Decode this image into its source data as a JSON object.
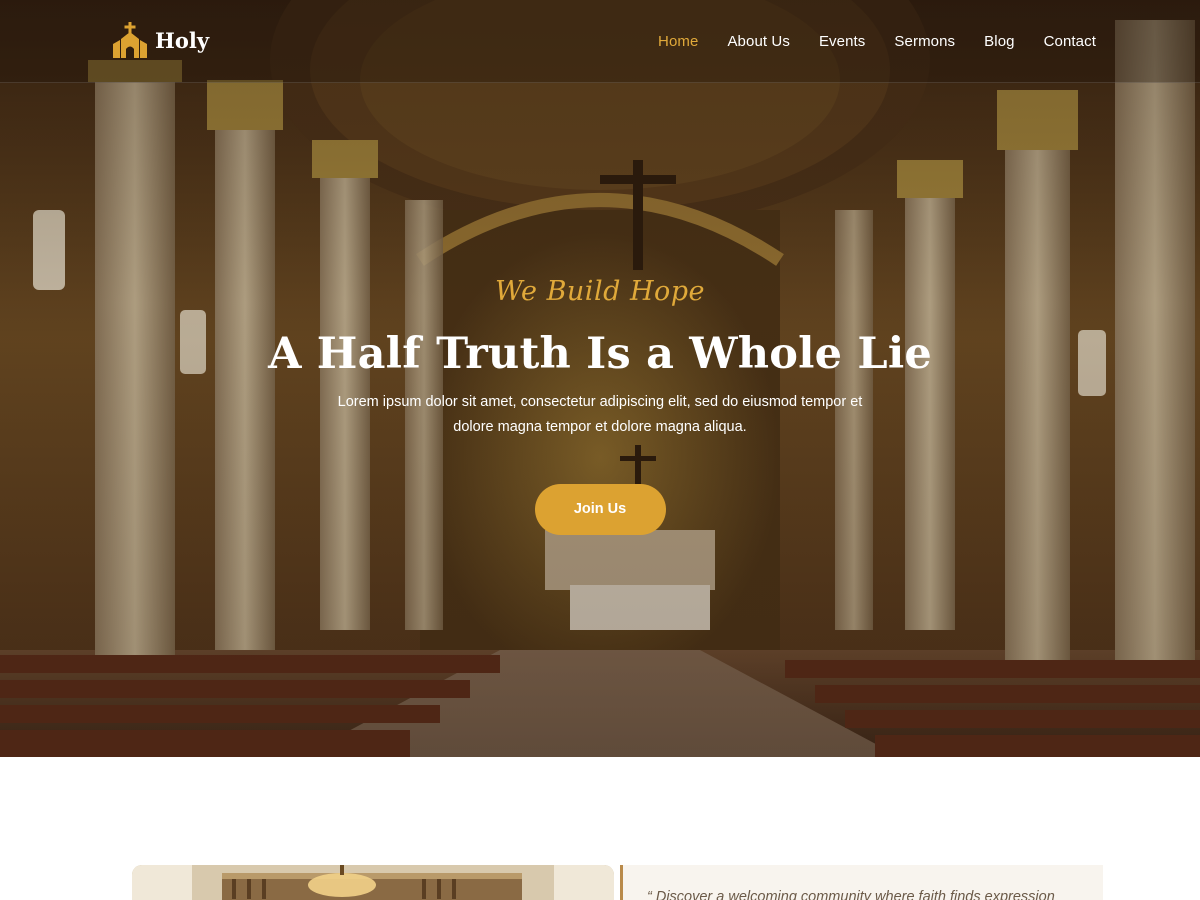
{
  "brand": {
    "name": "Holy",
    "icon": "church-icon",
    "accent_color": "#dca231"
  },
  "nav": {
    "items": [
      {
        "label": "Home",
        "active": true
      },
      {
        "label": "About Us",
        "active": false
      },
      {
        "label": "Events",
        "active": false
      },
      {
        "label": "Sermons",
        "active": false
      },
      {
        "label": "Blog",
        "active": false
      },
      {
        "label": "Contact",
        "active": false
      }
    ]
  },
  "hero": {
    "tagline": "We Build Hope",
    "title": "A Half Truth Is a Whole Lie",
    "description": "Lorem ipsum dolor sit amet, consectetur adipiscing elit, sed do eiusmod tempor et dolore magna tempor et dolore magna aliqua.",
    "cta_label": "Join Us"
  },
  "about": {
    "quote": "“ Discover a welcoming community where faith finds expression"
  }
}
